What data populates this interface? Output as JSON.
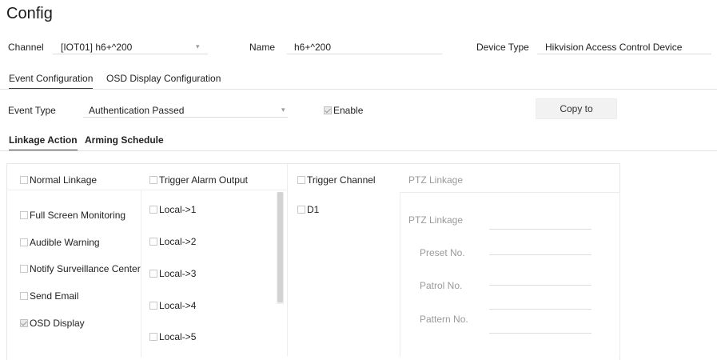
{
  "title": "Config",
  "channel": {
    "label": "Channel",
    "value": "[IOT01] h6+^200"
  },
  "name": {
    "label": "Name",
    "value": "h6+^200"
  },
  "device_type": {
    "label": "Device Type",
    "value": "Hikvision Access Control Device"
  },
  "main_tabs": [
    "Event Configuration",
    "OSD Display Configuration"
  ],
  "event_type": {
    "label": "Event Type",
    "value": "Authentication Passed"
  },
  "enable": {
    "label": "Enable",
    "checked": true
  },
  "copy_button": "Copy to",
  "sub_tabs": [
    "Linkage Action",
    "Arming Schedule"
  ],
  "normal_linkage": {
    "items": [
      {
        "label": "Normal Linkage",
        "checked": false
      },
      {
        "label": "Full Screen Monitoring",
        "checked": false
      },
      {
        "label": "Audible Warning",
        "checked": false
      },
      {
        "label": "Notify Surveillance Center",
        "checked": false
      },
      {
        "label": "Send Email",
        "checked": false
      },
      {
        "label": "OSD Display",
        "checked": true
      }
    ]
  },
  "alarm_output": {
    "header": "Trigger Alarm Output",
    "items": [
      "Local->1",
      "Local->2",
      "Local->3",
      "Local->4",
      "Local->5"
    ]
  },
  "trigger_channel": {
    "header": "Trigger Channel",
    "items": [
      "D1"
    ]
  },
  "ptz": {
    "header": "PTZ Linkage",
    "fields": [
      "PTZ Linkage",
      "Preset No.",
      "Patrol No.",
      "Pattern No."
    ]
  },
  "colors": {
    "active_tab_underline": "#3a3a3a",
    "disabled_text": "#9a9a9a"
  }
}
